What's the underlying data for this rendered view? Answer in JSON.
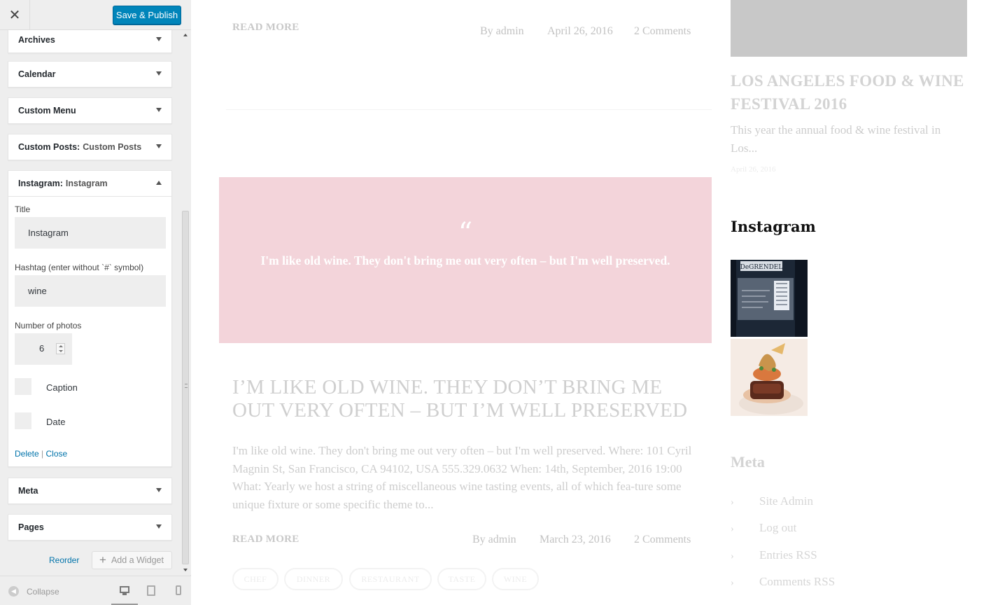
{
  "sidebar": {
    "close_icon": "close-icon",
    "publish_label": "Save & Publish",
    "widgets": [
      {
        "title": "Archives",
        "sub": ""
      },
      {
        "title": "Calendar",
        "sub": ""
      },
      {
        "title": "Custom Menu",
        "sub": ""
      },
      {
        "title": "Custom Posts:",
        "sub": "Custom Posts"
      },
      {
        "title": "Instagram:",
        "sub": "Instagram"
      },
      {
        "title": "Meta",
        "sub": ""
      },
      {
        "title": "Pages",
        "sub": ""
      }
    ],
    "instagram_form": {
      "title_label": "Title",
      "title_value": "Instagram",
      "hashtag_label": "Hashtag (enter without `#` symbol)",
      "hashtag_value": "wine",
      "number_label": "Number of photos",
      "number_value": "6",
      "caption_label": "Caption",
      "date_label": "Date",
      "delete_label": "Delete",
      "separator": "|",
      "close_label": "Close"
    },
    "reorder_label": "Reorder",
    "add_widget_label": "Add a Widget",
    "collapse_label": "Collapse"
  },
  "preview": {
    "post1": {
      "read_more": "READ MORE",
      "author": "By admin",
      "date": "April 26, 2016",
      "comments": "2 Comments"
    },
    "quote": {
      "mark": "“",
      "text": "I'm like old wine. They don't bring me out very often – but I'm well preserved."
    },
    "post2": {
      "title": "I’M LIKE OLD WINE. THEY DON’T BRING ME OUT VERY OFTEN – BUT I’M WELL PRESERVED",
      "excerpt": "I'm like old wine. They don't bring me out very often – but I'm well preserved. Where: 101 Cyril Magnin St, San Francisco, CA 94102, USA 555.329.0632 When: 14th, September, 2016 19:00 What: Yearly we host a string of miscellaneous wine tasting events, all of which fea-ture some unique fixture or some specific theme to...",
      "read_more": "READ MORE",
      "author": "By admin",
      "date": "March 23, 2016",
      "comments": "2 Comments",
      "tags": [
        "CHEF",
        "DINNER",
        "RESTAURANT",
        "TASTE",
        "WINE"
      ]
    },
    "side_post": {
      "title": "LOS ANGELES FOOD & WINE FESTIVAL 2016",
      "excerpt": "This year the annual food & wine festival in Los...",
      "date": "April 26, 2016"
    },
    "instagram": {
      "title": "Instagram",
      "bottle_label": "DeGRENDEL"
    },
    "meta": {
      "title": "Meta",
      "items": [
        "Site Admin",
        "Log out",
        "Entries RSS",
        "Comments RSS"
      ],
      "underlined": [
        "",
        "",
        "RSS",
        "RSS"
      ]
    }
  },
  "colors": {
    "publish_blue": "#0085ba",
    "link_blue": "#0073aa",
    "quote_pink": "#f3d4da",
    "sidebar_bg": "#eeeeee"
  }
}
